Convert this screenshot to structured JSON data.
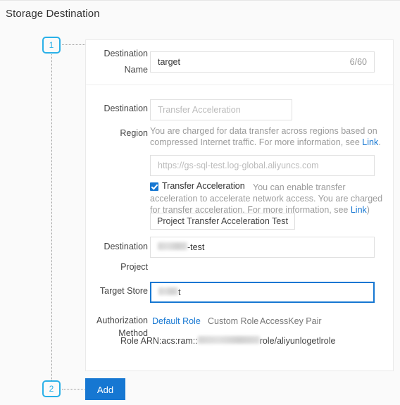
{
  "page": {
    "title": "Storage Destination"
  },
  "steps": [
    {
      "number": "1"
    },
    {
      "number": "2"
    }
  ],
  "icons": {
    "delete": "close-circle-icon"
  },
  "colors": {
    "accent": "#1677d2",
    "step_badge": "#2ab0e8",
    "danger": "#e8413c",
    "placeholder": "#bbbbbb",
    "muted": "#9b9b9b"
  },
  "form": {
    "destination_name": {
      "label_line1": "Destination",
      "label_line2": "Name",
      "value": "target",
      "counter": "6/60"
    },
    "destination_region": {
      "label_line1": "Destination",
      "label_line2": "Region",
      "placeholder": "Transfer Acceleration",
      "help_line1": "You are charged for data transfer across regions based on",
      "help_line2_prefix": "compressed Internet traffic. For more information, see ",
      "help_link": "Link",
      "help_line2_suffix": ".",
      "endpoint_placeholder": "https://gs-sql-test.log-global.aliyuncs.com"
    },
    "transfer_acceleration": {
      "checkbox_label": "Transfer Acceleration",
      "checked": true,
      "help_line1": "You can enable transfer",
      "help_line2": "acceleration to accelerate network access. You are charged",
      "help_line3_prefix": "for transfer acceleration. For more information, see ",
      "help_link": "Link",
      "help_line3_suffix": ")",
      "test_button": "Project Transfer Acceleration Test"
    },
    "destination_project": {
      "label_line1": "Destination",
      "label_line2": "Project",
      "value_redacted_prefix": "",
      "value_suffix": "-test",
      "value_visible_lead": "",
      "value_full_hint": "sql-test"
    },
    "target_store": {
      "label": "Target Store",
      "value_suffix": "t",
      "focused": true
    },
    "authorization": {
      "label_line1": "Authorization",
      "label_line2": "Method",
      "tabs": [
        {
          "label": "Default Role",
          "selected": true
        },
        {
          "label": "Custom Role",
          "selected": false
        },
        {
          "label": "AccessKey Pair",
          "selected": false
        }
      ],
      "arn_prefix": "Role ARN:acs:ram::",
      "arn_suffix": "role/aliyunlogetlrole"
    }
  },
  "actions": {
    "add_label": "Add"
  }
}
